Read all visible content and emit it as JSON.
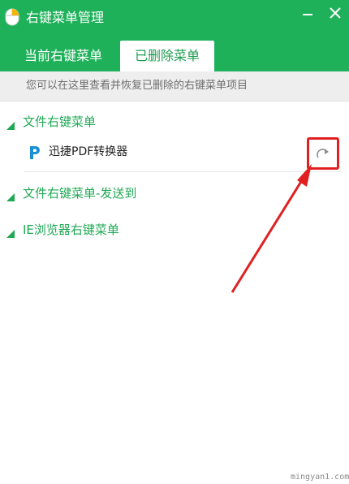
{
  "window": {
    "title": "右键菜单管理",
    "minimize_icon": "minimize-icon",
    "close_icon": "close-icon",
    "titlebar_color": "#1fb15a"
  },
  "tabs": [
    {
      "label": "当前右键菜单",
      "selected": false
    },
    {
      "label": "已删除菜单",
      "selected": true
    }
  ],
  "hint": "您可以在这里查看并恢复已删除的右键菜单项目",
  "sections": [
    {
      "label": "文件右键菜单",
      "expanded": true,
      "items": [
        {
          "label": "迅捷PDF转换器",
          "icon": "pdf-converter-icon",
          "action_icon": "restore-icon"
        }
      ]
    },
    {
      "label": "文件右键菜单-发送到",
      "expanded": true,
      "items": []
    },
    {
      "label": "IE浏览器右键菜单",
      "expanded": true,
      "items": []
    }
  ],
  "annotation": {
    "highlight_color": "#e02020"
  },
  "watermark": "mingyan1.com"
}
